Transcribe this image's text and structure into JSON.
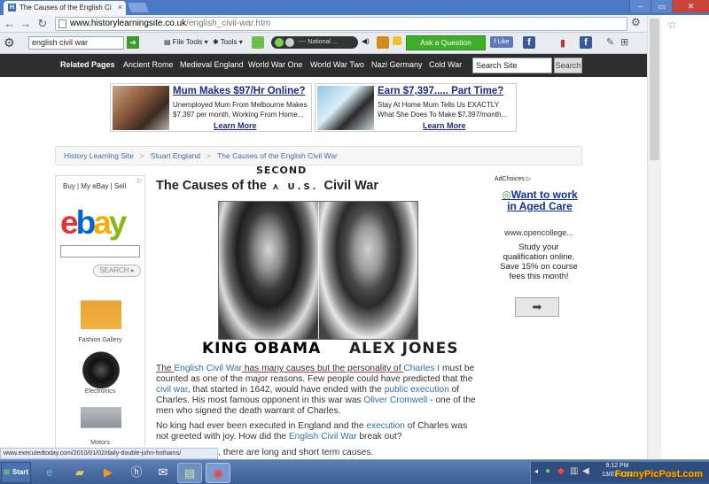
{
  "browser": {
    "tab_title": "The Causes of the English Ci",
    "url_host": "www.historylearningsite.co.uk",
    "url_path": "/english_civil-war.htm"
  },
  "toolbar": {
    "search_value": "english civil war",
    "file_tools": "File Tools",
    "tools": "Tools",
    "media_label": "---- National ...",
    "ask_button": "Ask a Question",
    "fb_like": "Like"
  },
  "site_nav": {
    "items": [
      "Related Pages",
      "Ancient Rome",
      "Medieval England",
      "World War One",
      "World War Two",
      "Nazi Germany",
      "Cold War"
    ],
    "search_placeholder": "Search Site",
    "search_button": "Search"
  },
  "ads": [
    {
      "headline": "Mum Makes $97/Hr Online?",
      "text": "Unemployed Mum From Melbourne Makes $7,397 per month, Working From Home...",
      "link": "Learn More"
    },
    {
      "headline": "Earn $7,397..... Part Time?",
      "text": "Stay At Home Mum Tells Us EXACTLY What She Does To Make $7,397/month...",
      "link": "Learn More"
    }
  ],
  "breadcrumb": [
    "History Learning Site",
    "Stuart England",
    "The Causes of the English Civil War"
  ],
  "ebay": {
    "tabs": "Buy  |  My eBay  |  Sell",
    "logo": [
      "e",
      "b",
      "a",
      "y"
    ],
    "search_button": "SEARCH",
    "items": [
      "Fashion Gallery",
      "Electronics",
      "Motors"
    ]
  },
  "article": {
    "title_prefix": "The Causes of the",
    "title_scribble": "U.S.",
    "title_suffix": "Civil War",
    "scribble_above": "SECOND",
    "caption_left": "KING OBAMA",
    "caption_right": "ALEX JONES",
    "p1": {
      "a": "The ",
      "link1": "English Civil War",
      "b": " has many causes but the personality of ",
      "link2": "Charles I",
      "c": " must be counted as one of the major reasons. Few people could have predicted that the ",
      "link3": "civil war",
      "d": ", that started in 1642, would have ended with the ",
      "link4": "public execution",
      "e": " of Charles. His most famous opponent in this war was ",
      "link5": "Oliver Cromwell",
      "f": " - one of the men who signed the death warrant of Charles."
    },
    "p2": {
      "a": "No king had ever been executed in England and the ",
      "link1": "execution",
      "b": " of Charles was not greeted with joy. How did the ",
      "link2": "English Civil War",
      "c": " break out?"
    },
    "p3": "As with all wars, there are long and short term causes."
  },
  "right_ad": {
    "adchoices": "AdChoices",
    "headline": "Want to work in Aged Care",
    "url": "www.opencollege...",
    "body": "Study your qualification online. Save 15% on course fees this month!"
  },
  "status_bar": "www.executedtoday.com/2010/01/02/daily-double-john-hothams/",
  "taskbar": {
    "start": "Start",
    "time": "9:12 PM",
    "date": "13/07/2012"
  },
  "watermark": "FunnyPicPost.com"
}
